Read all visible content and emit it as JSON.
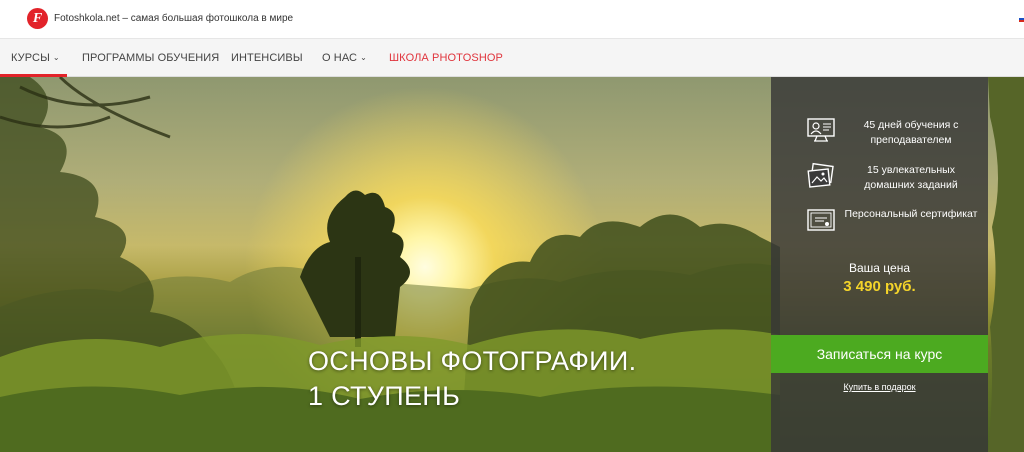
{
  "header": {
    "logo_letter": "F",
    "site_name": "Fotoshkola.net – самая большая фотошкола в мире",
    "language_flag_icon": "flag-ru-icon"
  },
  "nav": {
    "items": [
      {
        "label": "КУРСЫ",
        "has_dropdown": true
      },
      {
        "label": "ПРОГРАММЫ ОБУЧЕНИЯ",
        "has_dropdown": false
      },
      {
        "label": "ИНТЕНСИВЫ",
        "has_dropdown": false
      },
      {
        "label": "О НАС",
        "has_dropdown": true
      },
      {
        "label": "ШКОЛА PHOTOSHOP",
        "has_dropdown": false
      }
    ],
    "chevron": "⌄",
    "active_color": "#e2232a"
  },
  "hero": {
    "title_line1": "ОСНОВЫ ФОТОГРАФИИ.",
    "title_line2": "1 СТУПЕНЬ",
    "background": "sunrise-forest-photo"
  },
  "panel": {
    "features": [
      {
        "icon": "monitor-teacher-icon",
        "text": "45 дней обучения с преподавателем"
      },
      {
        "icon": "photos-icon",
        "text": "15 увлекательных домашних заданий"
      },
      {
        "icon": "certificate-icon",
        "text": "Персональный сертификат"
      }
    ],
    "price_label": "Ваша цена",
    "price": "3 490 руб.",
    "cta_label": "Записаться на курс",
    "gift_link": "Купить в подарок",
    "cta_color": "#4caa20",
    "price_color": "#f4d42a"
  }
}
